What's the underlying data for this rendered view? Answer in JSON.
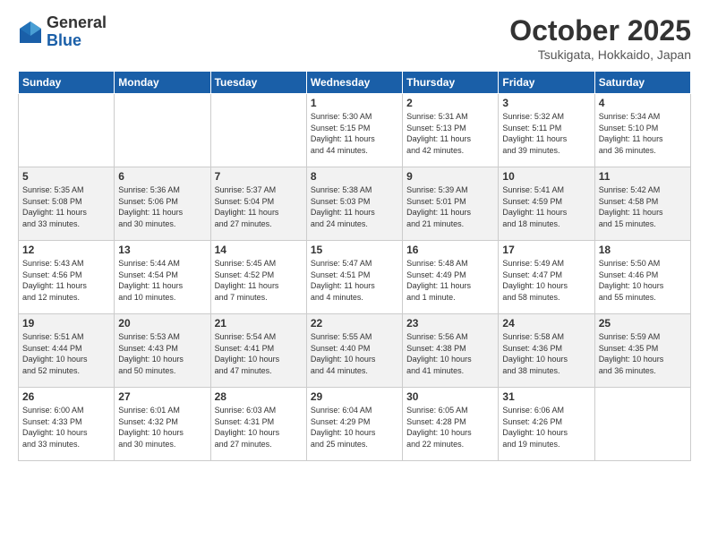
{
  "logo": {
    "general": "General",
    "blue": "Blue"
  },
  "header": {
    "month": "October 2025",
    "location": "Tsukigata, Hokkaido, Japan"
  },
  "weekdays": [
    "Sunday",
    "Monday",
    "Tuesday",
    "Wednesday",
    "Thursday",
    "Friday",
    "Saturday"
  ],
  "weeks": [
    [
      {
        "date": "",
        "info": ""
      },
      {
        "date": "",
        "info": ""
      },
      {
        "date": "",
        "info": ""
      },
      {
        "date": "1",
        "info": "Sunrise: 5:30 AM\nSunset: 5:15 PM\nDaylight: 11 hours\nand 44 minutes."
      },
      {
        "date": "2",
        "info": "Sunrise: 5:31 AM\nSunset: 5:13 PM\nDaylight: 11 hours\nand 42 minutes."
      },
      {
        "date": "3",
        "info": "Sunrise: 5:32 AM\nSunset: 5:11 PM\nDaylight: 11 hours\nand 39 minutes."
      },
      {
        "date": "4",
        "info": "Sunrise: 5:34 AM\nSunset: 5:10 PM\nDaylight: 11 hours\nand 36 minutes."
      }
    ],
    [
      {
        "date": "5",
        "info": "Sunrise: 5:35 AM\nSunset: 5:08 PM\nDaylight: 11 hours\nand 33 minutes."
      },
      {
        "date": "6",
        "info": "Sunrise: 5:36 AM\nSunset: 5:06 PM\nDaylight: 11 hours\nand 30 minutes."
      },
      {
        "date": "7",
        "info": "Sunrise: 5:37 AM\nSunset: 5:04 PM\nDaylight: 11 hours\nand 27 minutes."
      },
      {
        "date": "8",
        "info": "Sunrise: 5:38 AM\nSunset: 5:03 PM\nDaylight: 11 hours\nand 24 minutes."
      },
      {
        "date": "9",
        "info": "Sunrise: 5:39 AM\nSunset: 5:01 PM\nDaylight: 11 hours\nand 21 minutes."
      },
      {
        "date": "10",
        "info": "Sunrise: 5:41 AM\nSunset: 4:59 PM\nDaylight: 11 hours\nand 18 minutes."
      },
      {
        "date": "11",
        "info": "Sunrise: 5:42 AM\nSunset: 4:58 PM\nDaylight: 11 hours\nand 15 minutes."
      }
    ],
    [
      {
        "date": "12",
        "info": "Sunrise: 5:43 AM\nSunset: 4:56 PM\nDaylight: 11 hours\nand 12 minutes."
      },
      {
        "date": "13",
        "info": "Sunrise: 5:44 AM\nSunset: 4:54 PM\nDaylight: 11 hours\nand 10 minutes."
      },
      {
        "date": "14",
        "info": "Sunrise: 5:45 AM\nSunset: 4:52 PM\nDaylight: 11 hours\nand 7 minutes."
      },
      {
        "date": "15",
        "info": "Sunrise: 5:47 AM\nSunset: 4:51 PM\nDaylight: 11 hours\nand 4 minutes."
      },
      {
        "date": "16",
        "info": "Sunrise: 5:48 AM\nSunset: 4:49 PM\nDaylight: 11 hours\nand 1 minute."
      },
      {
        "date": "17",
        "info": "Sunrise: 5:49 AM\nSunset: 4:47 PM\nDaylight: 10 hours\nand 58 minutes."
      },
      {
        "date": "18",
        "info": "Sunrise: 5:50 AM\nSunset: 4:46 PM\nDaylight: 10 hours\nand 55 minutes."
      }
    ],
    [
      {
        "date": "19",
        "info": "Sunrise: 5:51 AM\nSunset: 4:44 PM\nDaylight: 10 hours\nand 52 minutes."
      },
      {
        "date": "20",
        "info": "Sunrise: 5:53 AM\nSunset: 4:43 PM\nDaylight: 10 hours\nand 50 minutes."
      },
      {
        "date": "21",
        "info": "Sunrise: 5:54 AM\nSunset: 4:41 PM\nDaylight: 10 hours\nand 47 minutes."
      },
      {
        "date": "22",
        "info": "Sunrise: 5:55 AM\nSunset: 4:40 PM\nDaylight: 10 hours\nand 44 minutes."
      },
      {
        "date": "23",
        "info": "Sunrise: 5:56 AM\nSunset: 4:38 PM\nDaylight: 10 hours\nand 41 minutes."
      },
      {
        "date": "24",
        "info": "Sunrise: 5:58 AM\nSunset: 4:36 PM\nDaylight: 10 hours\nand 38 minutes."
      },
      {
        "date": "25",
        "info": "Sunrise: 5:59 AM\nSunset: 4:35 PM\nDaylight: 10 hours\nand 36 minutes."
      }
    ],
    [
      {
        "date": "26",
        "info": "Sunrise: 6:00 AM\nSunset: 4:33 PM\nDaylight: 10 hours\nand 33 minutes."
      },
      {
        "date": "27",
        "info": "Sunrise: 6:01 AM\nSunset: 4:32 PM\nDaylight: 10 hours\nand 30 minutes."
      },
      {
        "date": "28",
        "info": "Sunrise: 6:03 AM\nSunset: 4:31 PM\nDaylight: 10 hours\nand 27 minutes."
      },
      {
        "date": "29",
        "info": "Sunrise: 6:04 AM\nSunset: 4:29 PM\nDaylight: 10 hours\nand 25 minutes."
      },
      {
        "date": "30",
        "info": "Sunrise: 6:05 AM\nSunset: 4:28 PM\nDaylight: 10 hours\nand 22 minutes."
      },
      {
        "date": "31",
        "info": "Sunrise: 6:06 AM\nSunset: 4:26 PM\nDaylight: 10 hours\nand 19 minutes."
      },
      {
        "date": "",
        "info": ""
      }
    ]
  ]
}
